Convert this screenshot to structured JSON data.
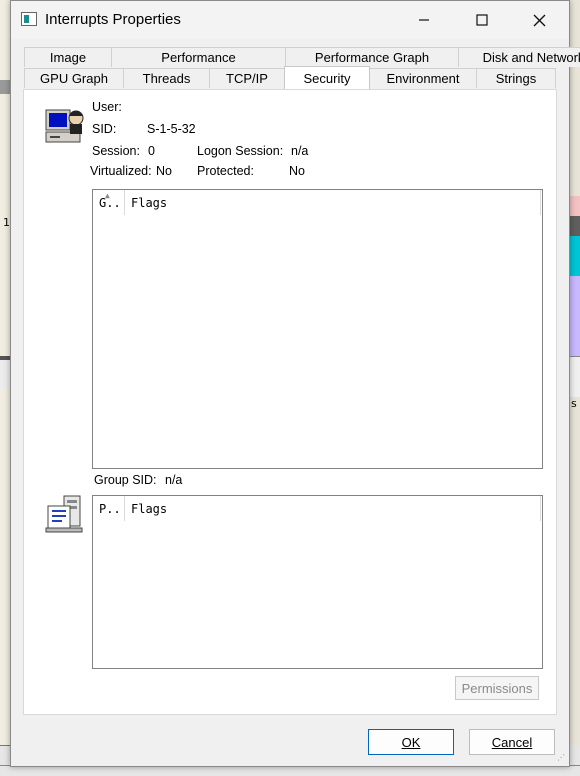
{
  "window": {
    "title": "Interrupts Properties"
  },
  "background": {
    "left_number": "1",
    "right_letter": "s"
  },
  "tabs": {
    "back_row": [
      {
        "label": "Image",
        "w": 88
      },
      {
        "label": "Performance",
        "w": 175
      },
      {
        "label": "Performance Graph",
        "w": 174
      },
      {
        "label": "Disk and Network",
        "w": 151
      }
    ],
    "front_row": [
      {
        "label": "GPU Graph",
        "w": 100
      },
      {
        "label": "Threads",
        "w": 87
      },
      {
        "label": "TCP/IP",
        "w": 76
      },
      {
        "label": "Security",
        "w": 86
      },
      {
        "label": "Environment",
        "w": 108
      },
      {
        "label": "Strings",
        "w": 80
      }
    ],
    "active": "Security"
  },
  "security": {
    "user_label": "User:",
    "user_value": "",
    "sid_label": "SID:",
    "sid_value": "S-1-5-32",
    "session_label": "Session:",
    "session_value": "0",
    "logon_session_label": "Logon Session:",
    "logon_session_value": "n/a",
    "virtualized_label": "Virtualized:",
    "virtualized_value": "No",
    "protected_label": "Protected:",
    "protected_value": "No",
    "group_sid_label": "Group SID:",
    "group_sid_value": "n/a"
  },
  "groups_list": {
    "col1": "G..",
    "col2": "Flags"
  },
  "privileges_list": {
    "col1": "P..",
    "col2": "Flags"
  },
  "buttons": {
    "permissions": "Permissions",
    "ok": "OK",
    "cancel": "Cancel"
  }
}
